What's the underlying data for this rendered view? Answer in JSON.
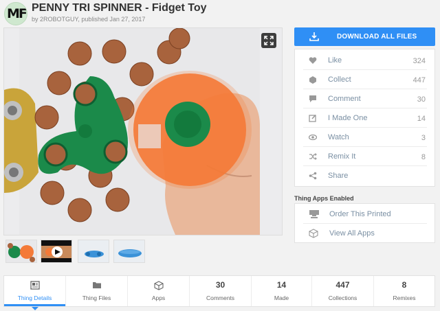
{
  "header": {
    "logo_text": "MF",
    "title": "PENNY TRI SPINNER - Fidget Toy",
    "byline": "by 2ROBOTGUY, published Jan 27, 2017"
  },
  "photo": {
    "expand_icon": "expand-icon"
  },
  "thumbnails": [
    {
      "name": "thumb-1",
      "icon": "photo-thumbnail"
    },
    {
      "name": "thumb-2-video",
      "icon": "play-icon"
    },
    {
      "name": "thumb-3",
      "icon": "model-render-thumbnail"
    },
    {
      "name": "thumb-4",
      "icon": "model-render-thumbnail"
    }
  ],
  "download": {
    "label": "DOWNLOAD ALL FILES",
    "icon": "download-icon"
  },
  "actions": [
    {
      "label": "Like",
      "count": "324",
      "icon": "heart-icon"
    },
    {
      "label": "Collect",
      "count": "447",
      "icon": "collect-icon"
    },
    {
      "label": "Comment",
      "count": "30",
      "icon": "comment-icon"
    },
    {
      "label": "I Made One",
      "count": "14",
      "icon": "edit-icon"
    },
    {
      "label": "Watch",
      "count": "3",
      "icon": "eye-icon"
    },
    {
      "label": "Remix It",
      "count": "8",
      "icon": "shuffle-icon"
    },
    {
      "label": "Share",
      "count": "",
      "icon": "share-icon"
    }
  ],
  "apps": {
    "title": "Thing Apps Enabled",
    "items": [
      {
        "label": "Order This Printed",
        "icon": "printer-icon"
      },
      {
        "label": "View All Apps",
        "icon": "cube-icon"
      }
    ]
  },
  "tabs": [
    {
      "label": "Thing Details",
      "num": "",
      "icon": "details-icon",
      "active": true
    },
    {
      "label": "Thing Files",
      "num": "",
      "icon": "folder-icon"
    },
    {
      "label": "Apps",
      "num": "",
      "icon": "cube-icon"
    },
    {
      "label": "Comments",
      "num": "30"
    },
    {
      "label": "Made",
      "num": "14"
    },
    {
      "label": "Collections",
      "num": "447"
    },
    {
      "label": "Remixes",
      "num": "8"
    }
  ],
  "colors": {
    "accent": "#2f8ff5",
    "spinner_orange": "#f47a38",
    "spinner_green": "#1b8a4a"
  }
}
